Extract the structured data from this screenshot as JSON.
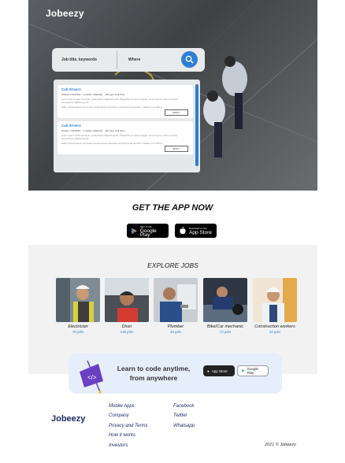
{
  "header": {
    "logo": "Jobeezy"
  },
  "search": {
    "job_placeholder": "Job title, keywords",
    "where_placeholder": "Where"
  },
  "listings": [
    {
      "title": "Cab drivers",
      "posted": "Posted: 7/11/2019",
      "location": "Location: Mabuhai",
      "job_type": "Job type: Full Time",
      "description": "Lorem ipsum dolor sit amet, consectetur adipiscing elit. Phasellus at metus magna. Lorem ipsum dolor sit amet, consectetur adipiscing elit.",
      "skills": "skills: Suspendisse commodo condimentum hendrerit sed finibus elementum. Nullam non nibh ipsum",
      "apply": "APPLY"
    },
    {
      "title": "Cab drivers",
      "posted": "Posted: 7/11/2019",
      "location": "Location: Mabuhai",
      "job_type": "Job type: Full Time",
      "description": "Lorem ipsum dolor sit amet, consectetur adipiscing elit. Phasellus at metus magna. Lorem ipsum dolor sit amet, consectetur adipiscing elit.",
      "skills": "skills: Suspendisse commodo condimentum hendrerit sed finibus elementum. Nullam non nibh ipsum",
      "apply": "APPLY"
    }
  ],
  "get_app": {
    "title": "GET THE APP NOW",
    "google_small": "GET IT ON",
    "google_big": "Google Play",
    "apple_small": "Download on the",
    "apple_big": "App Store"
  },
  "explore": {
    "title": "EXPLORE JOBS",
    "jobs": [
      {
        "name": "Electrician",
        "count": "70 jobs"
      },
      {
        "name": "Diver",
        "count": "135 jobs"
      },
      {
        "name": "Plumber",
        "count": "46 jobs"
      },
      {
        "name": "Bike/Car mechanic",
        "count": "72 jobs"
      },
      {
        "name": "Construction workers",
        "count": "10 jobs"
      }
    ]
  },
  "banner": {
    "line1": "Learn to code anytime,",
    "line2": "from anywhere",
    "apple_label": "App Store",
    "google_label": "Google Play"
  },
  "footer": {
    "logo": "Jobeezy",
    "col1": [
      "Mobile Apps",
      "Company",
      "Privacy and Terms",
      "How it works",
      "Investors"
    ],
    "col2": [
      "Facebook",
      "Twitter",
      "Whatsapp"
    ],
    "copyright": "2021 © Jobeezy"
  },
  "colors": {
    "accent": "#2f7fd3",
    "brand_dark": "#1f2a66",
    "banner_bg": "#e7eefb"
  },
  "icons": [
    "search-icon",
    "google-play-icon",
    "apple-icon",
    "flag-code-icon"
  ]
}
